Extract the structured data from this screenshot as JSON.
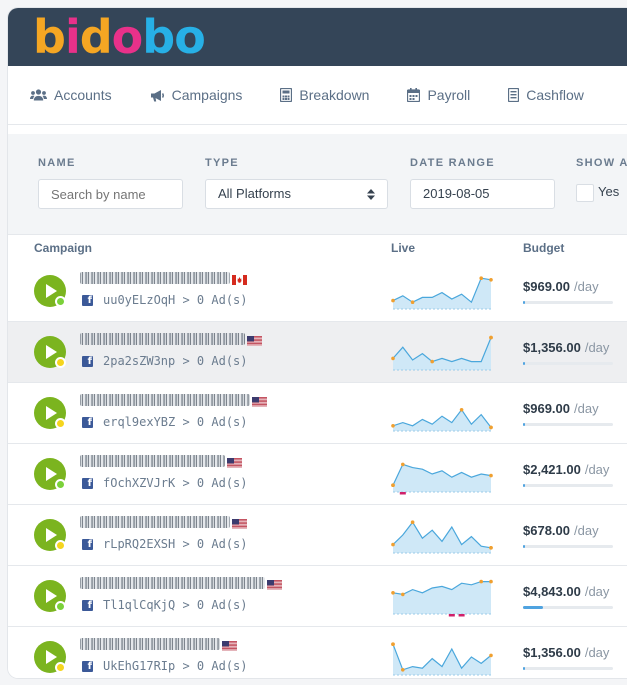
{
  "app": {
    "logo_letters": [
      {
        "ch": "b",
        "color": "#f5a623"
      },
      {
        "ch": "i",
        "color": "#e8318a"
      },
      {
        "ch": "d",
        "color": "#f5a623"
      },
      {
        "ch": "o",
        "color": "#e8318a"
      },
      {
        "ch": "b",
        "color": "#27b0e6"
      },
      {
        "ch": "o",
        "color": "#27b0e6"
      }
    ]
  },
  "nav": {
    "accounts": "Accounts",
    "campaigns": "Campaigns",
    "breakdown": "Breakdown",
    "payroll": "Payroll",
    "cashflow": "Cashflow"
  },
  "filters": {
    "name_label": "NAME",
    "name_placeholder": "Search by name",
    "type_label": "TYPE",
    "type_value": "All Platforms",
    "date_label": "DATE RANGE",
    "date_value": "2019-08-05",
    "show_label": "SHOW A",
    "show_option": "Yes"
  },
  "table": {
    "col_campaign": "Campaign",
    "col_live": "Live",
    "col_budget": "Budget",
    "per_day": "/day",
    "rows": [
      {
        "sub": "uu0yELzOqH > 0 Ad(s)",
        "flag": "ca",
        "status": "green",
        "budget": "$969.00",
        "budget_level": 0.02,
        "spark": [
          0.2,
          0.35,
          0.15,
          0.3,
          0.3,
          0.45,
          0.25,
          0.4,
          0.15,
          0.9,
          0.85
        ],
        "red_marks": []
      },
      {
        "sub": "2pa2sZW3np > 0 Ad(s)",
        "flag": "us",
        "status": "yellow",
        "budget": "$1,356.00",
        "budget_level": 0.02,
        "spark": [
          0.3,
          0.65,
          0.25,
          0.45,
          0.2,
          0.3,
          0.2,
          0.3,
          0.2,
          0.2,
          0.95
        ],
        "red_marks": []
      },
      {
        "sub": "erql9exYBZ > 0 Ad(s)",
        "flag": "us",
        "status": "yellow",
        "budget": "$969.00",
        "budget_level": 0.02,
        "spark": [
          0.1,
          0.2,
          0.1,
          0.3,
          0.15,
          0.4,
          0.2,
          0.6,
          0.15,
          0.45,
          0.05
        ],
        "red_marks": []
      },
      {
        "sub": "fOchXZVJrK > 0 Ad(s)",
        "flag": "us",
        "status": "green",
        "budget": "$2,421.00",
        "budget_level": 0.02,
        "spark": [
          0.15,
          0.8,
          0.7,
          0.65,
          0.5,
          0.6,
          0.4,
          0.55,
          0.4,
          0.5,
          0.45
        ],
        "red_marks": [
          1
        ]
      },
      {
        "sub": "rLpRQ2EXSH > 0 Ad(s)",
        "flag": "us",
        "status": "yellow",
        "budget": "$678.00",
        "budget_level": 0.02,
        "spark": [
          0.2,
          0.5,
          0.9,
          0.4,
          0.65,
          0.3,
          0.75,
          0.2,
          0.45,
          0.15,
          0.1
        ],
        "red_marks": []
      },
      {
        "sub": "Tl1qlCqKjQ > 0 Ad(s)",
        "flag": "us",
        "status": "green",
        "budget": "$4,843.00",
        "budget_level": 0.22,
        "spark": [
          0.6,
          0.55,
          0.7,
          0.6,
          0.75,
          0.8,
          0.7,
          0.9,
          0.85,
          0.95,
          0.95
        ],
        "red_marks": [
          6,
          7
        ]
      },
      {
        "sub": "UkEhG17RIp > 0 Ad(s)",
        "flag": "us",
        "status": "yellow",
        "budget": "$1,356.00",
        "budget_level": 0.02,
        "spark": [
          0.9,
          0.1,
          0.2,
          0.15,
          0.45,
          0.2,
          0.75,
          0.15,
          0.5,
          0.3,
          0.55
        ],
        "red_marks": []
      }
    ]
  },
  "colors": {
    "topbar": "#344558",
    "play": "#7bb41f",
    "spark_line": "#4aa7dc",
    "spark_fill": "#cfe8f7",
    "spark_dot": "#f0a030",
    "red_mark": "#d0206a"
  }
}
